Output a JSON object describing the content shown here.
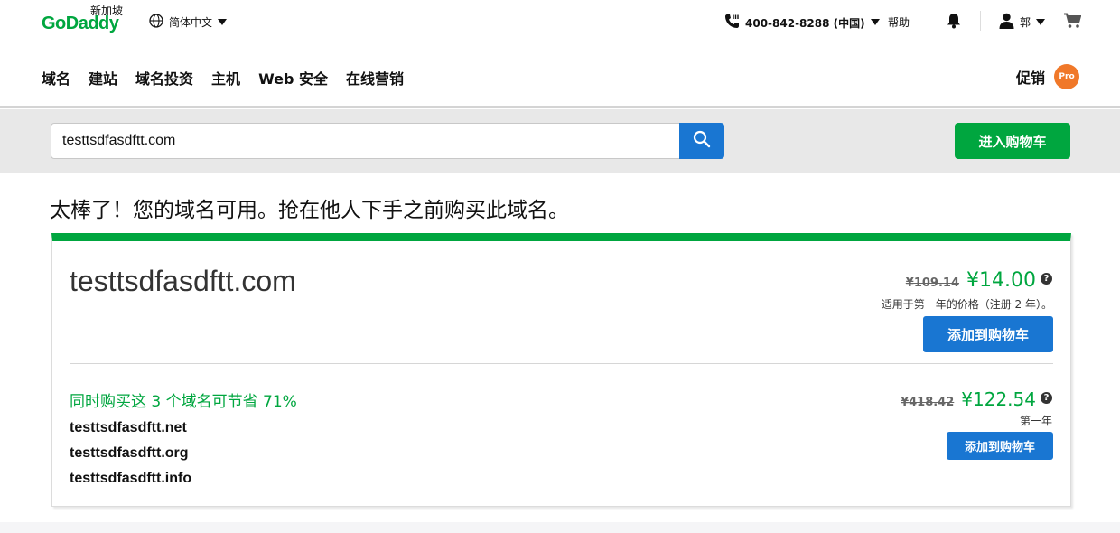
{
  "header": {
    "logo_text": "GoDaddy",
    "region_label": "新加坡",
    "language": "简体中文",
    "phone": "400-842-8288 (中国)",
    "help": "帮助",
    "user_name": "郭"
  },
  "nav": {
    "items": [
      "域名",
      "建站",
      "域名投资",
      "主机",
      "Web 安全",
      "在线营销"
    ],
    "promo_label": "促销",
    "pro_badge": "Pro"
  },
  "search": {
    "query": "testtsdfasdftt.com",
    "go_to_cart_label": "进入购物车"
  },
  "result": {
    "headline": "太棒了！您的域名可用。抢在他人下手之前购买此域名。",
    "domain": "testtsdfasdftt.com",
    "old_price": "¥109.14",
    "new_price": "¥14.00",
    "price_note": "适用于第一年的价格（注册 2 年）。",
    "add_to_cart_label": "添加到购物车",
    "bundle": {
      "title": "同时购买这 3 个域名可节省 71%",
      "domains": [
        "testtsdfasdftt.net",
        "testtsdfasdftt.org",
        "testtsdfasdftt.info"
      ],
      "old_price": "¥418.42",
      "new_price": "¥122.54",
      "price_note": "第一年",
      "add_to_cart_label": "添加到购物车"
    }
  },
  "colors": {
    "brand_green": "#00a63f",
    "action_blue": "#1976d2",
    "promo_orange": "#f07829"
  }
}
